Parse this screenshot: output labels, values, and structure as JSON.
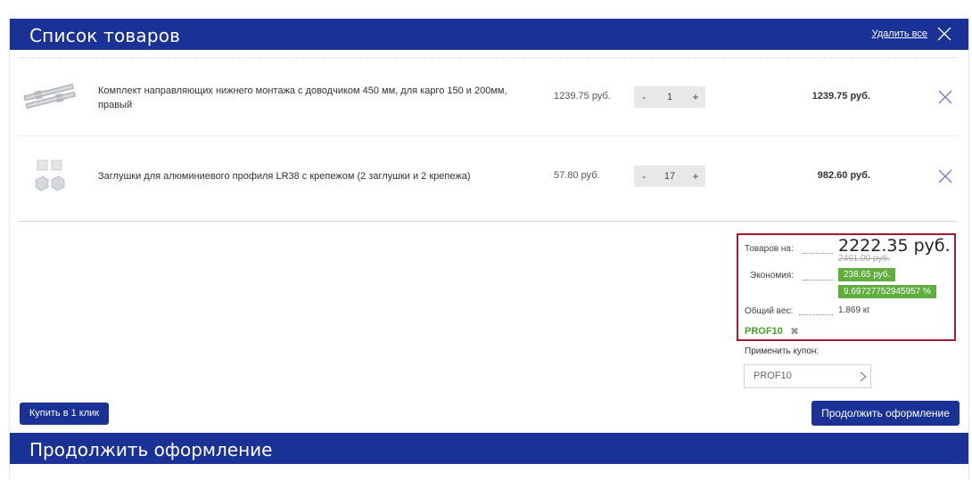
{
  "header": {
    "title": "Список товаров",
    "delete_all": "Удалить все"
  },
  "items": [
    {
      "name": "Комплект направляющих нижнего монтажа с доводчиком 450 мм, для карго 150 и 200мм, правый",
      "price": "1239.75 руб.",
      "qty_minus": "-",
      "quantity": "1",
      "qty_plus": "+",
      "total": "1239.75 руб."
    },
    {
      "name": "Заглушки для алюминиевого профиля LR38 с крепежом (2 заглушки и 2 крепежа)",
      "price": "57.80 руб.",
      "qty_minus": "-",
      "quantity": "17",
      "qty_plus": "+",
      "total": "982.60 руб."
    }
  ],
  "summary": {
    "goods_label": "Товаров на:",
    "goods_total": "2222.35 руб.",
    "old_total": "2461.00 руб.",
    "savings_label": "Экономия:",
    "savings_amount": "238.65 руб.",
    "savings_percent": "9.69727752945957 %",
    "weight_label": "Общий вес:",
    "weight_value": "1.869 кг",
    "coupon_code": "PROF10",
    "coupon_remove": "✖"
  },
  "coupon": {
    "label": "Применить купон:",
    "value": "PROF10"
  },
  "buttons": {
    "buy_one_click": "Купить в 1 клик",
    "continue_checkout": "Продолжить оформление"
  },
  "footer": {
    "title": "Продолжить оформление"
  },
  "colors": {
    "brand_blue": "#1a3196",
    "badge_green": "#5fae3e",
    "coupon_green": "#4aa02c",
    "highlight_border": "#a11d2e"
  },
  "icons": {
    "header_close": "close-icon",
    "row_remove": "close-icon",
    "coupon_remove": "close-icon",
    "coupon_arrow": "chevron-right-icon"
  }
}
